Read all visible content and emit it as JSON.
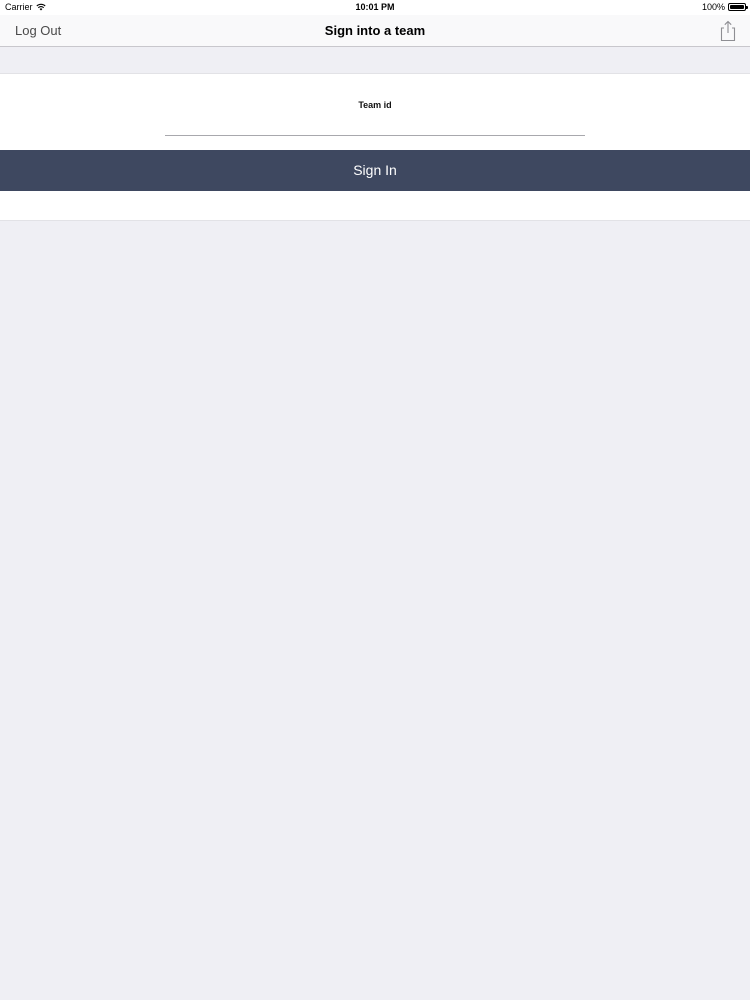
{
  "status_bar": {
    "carrier": "Carrier",
    "time": "10:01 PM",
    "battery": "100%"
  },
  "nav_bar": {
    "left_button": "Log Out",
    "title": "Sign into a team",
    "right_icon": "share-icon"
  },
  "form": {
    "team_label": "Team id",
    "team_input_value": "",
    "team_input_placeholder": ""
  },
  "sign_in": {
    "label": "Sign In"
  },
  "colors": {
    "background": "#efeff4",
    "button": "#3e4860",
    "button_text": "#ffffff",
    "card": "#ffffff"
  }
}
